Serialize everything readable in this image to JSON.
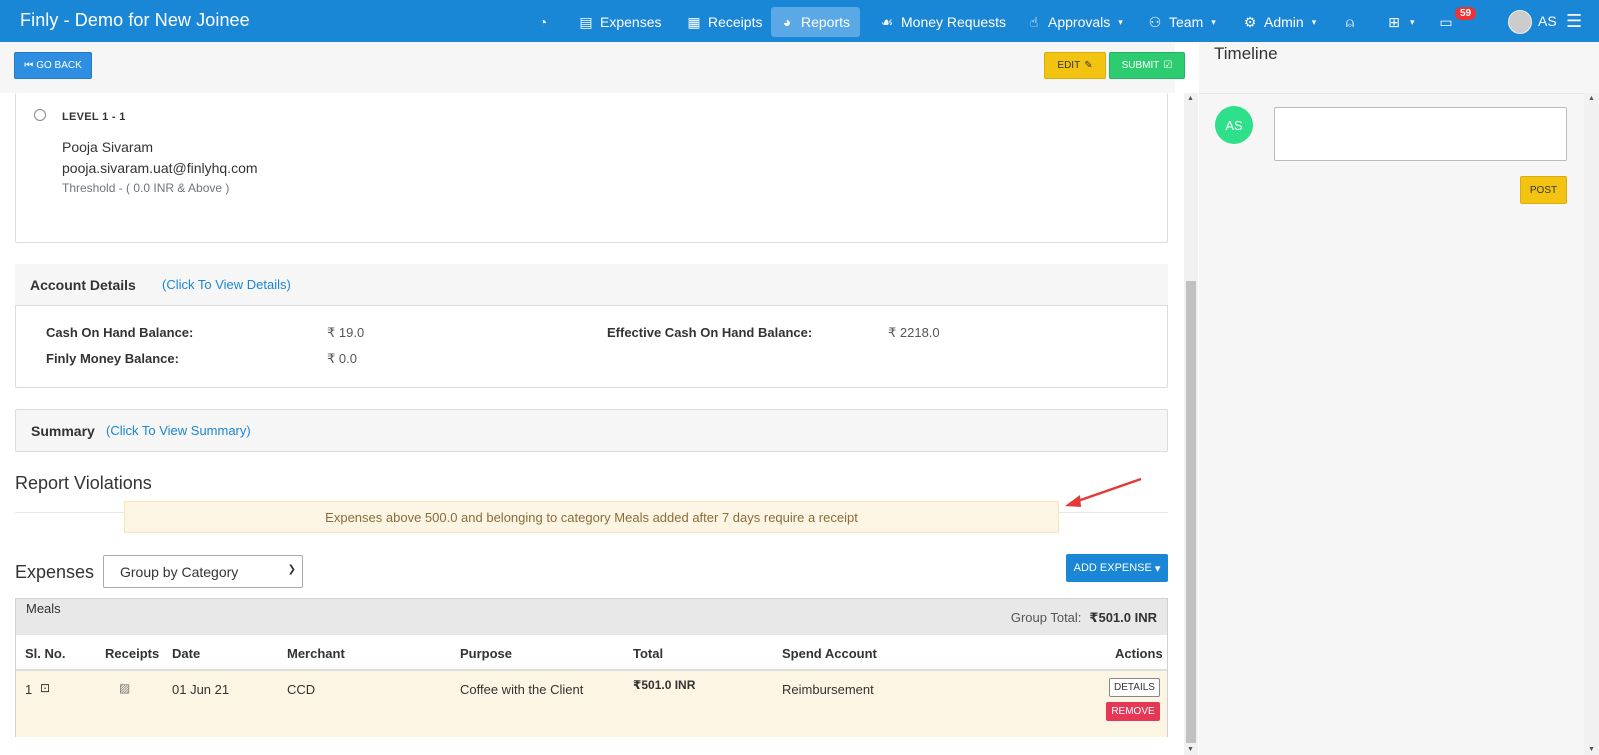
{
  "app": {
    "title": "Finly - Demo for New Joinee"
  },
  "nav": {
    "expenses": "Expenses",
    "receipts": "Receipts",
    "reports": "Reports",
    "money_requests": "Money Requests",
    "approvals": "Approvals",
    "team": "Team",
    "admin": "Admin",
    "notification_count": "59",
    "user_initials": "AS"
  },
  "toolbar": {
    "go_back": "GO BACK",
    "edit": "EDIT",
    "submit": "SUBMIT"
  },
  "approval_level": {
    "label": "LEVEL 1  -   1",
    "name": "Pooja Sivaram",
    "email": "pooja.sivaram.uat@finlyhq.com",
    "threshold": "Threshold -  ( 0.0 INR & Above )"
  },
  "account": {
    "title": "Account Details",
    "link": "(Click To View Details)",
    "cash_on_hand_label": "Cash On Hand Balance:",
    "cash_on_hand_value": "₹  19.0",
    "finly_money_label": "Finly Money Balance:",
    "finly_money_value": "₹  0.0",
    "effective_label": "Effective Cash On Hand Balance:",
    "effective_value": "₹  2218.0"
  },
  "summary": {
    "title": "Summary",
    "link": "(Click To View Summary)"
  },
  "violations": {
    "title": "Report Violations",
    "message": "Expenses above 500.0 and belonging to category Meals added after 7 days require a receipt"
  },
  "expenses": {
    "title": "Expenses",
    "group_by": "Group by Category",
    "add_button": "ADD EXPENSE",
    "group": {
      "name": "Meals",
      "total_label": "Group Total:",
      "total_value": "₹501.0 INR"
    },
    "columns": [
      "Sl. No.",
      "Receipts",
      "Date",
      "Merchant",
      "Purpose",
      "Total",
      "Spend Account",
      "Actions"
    ],
    "rows": [
      {
        "sl": "1",
        "date": "01 Jun 21",
        "merchant": "CCD",
        "purpose": "Coffee with the Client",
        "total": "₹501.0 INR",
        "spend_account": "Reimbursement",
        "details": "DETAILS",
        "remove": "REMOVE"
      }
    ]
  },
  "timeline": {
    "title": "Timeline",
    "avatar": "AS",
    "post": "POST"
  },
  "colors": {
    "brand": "#1a86d6",
    "edit": "#f2c311",
    "submit": "#2ecc71",
    "remove": "#e63757",
    "violation_bg": "#fcf5e3"
  }
}
